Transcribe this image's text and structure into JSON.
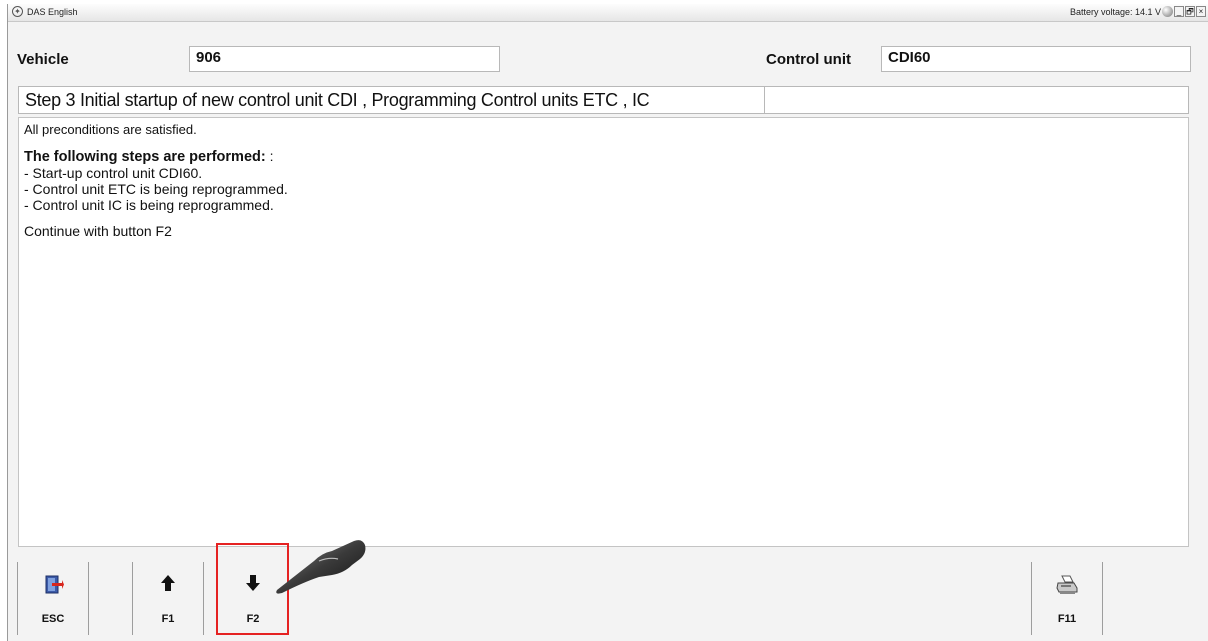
{
  "window": {
    "title": "DAS English",
    "battery": "Battery voltage: 14.1 V",
    "controls": [
      "_",
      "🗗",
      "×"
    ]
  },
  "header": {
    "vehicle_label": "Vehicle",
    "vehicle_value": "906",
    "control_unit_label": "Control unit",
    "control_unit_value": "CDI60"
  },
  "step": {
    "title": "Step 3 Initial startup of new control unit CDI , Programming Control units ETC , IC"
  },
  "content": {
    "line1": "All preconditions are satisfied.",
    "steps_heading": "The following steps are performed:",
    "steps_heading_suffix": " :",
    "items": [
      "- Start-up control unit CDI60.",
      "- Control unit ETC is being reprogrammed.",
      "- Control unit IC is being reprogrammed."
    ],
    "continue": "Continue with button F2"
  },
  "buttons": [
    {
      "label": "ESC",
      "icon": "exit-door-icon"
    },
    {
      "label": "F1",
      "icon": "arrow-up-icon"
    },
    {
      "label": "F2",
      "icon": "arrow-down-icon"
    },
    {
      "label": "F11",
      "icon": "printer-icon"
    }
  ],
  "colors": {
    "highlight": "#e52222",
    "window_bg": "#f3f3f3"
  }
}
